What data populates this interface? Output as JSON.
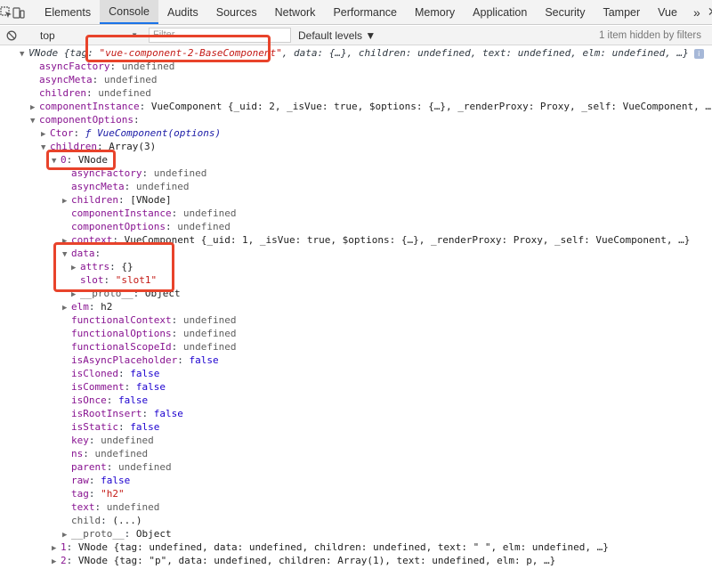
{
  "tabs": [
    "Elements",
    "Console",
    "Audits",
    "Sources",
    "Network",
    "Performance",
    "Memory",
    "Application",
    "Security",
    "Tamper",
    "Vue"
  ],
  "selected_tab": "Console",
  "more_tabs": "»",
  "toolbar": {
    "context": "top",
    "filter_placeholder": "Filter",
    "levels": "Default levels ▼",
    "hidden_count": "1 item hidden by filters"
  },
  "colors": {
    "highlight": "#e8432b",
    "tab_accent": "#1a73e8"
  },
  "console": {
    "root": {
      "head": "VNode {tag: ",
      "tag": "\"vue-component-2-BaseComponent\"",
      "tail": ", data: {…}, children: undefined, text: undefined, elm: undefined, …}"
    },
    "lines": [
      {
        "k": "asyncFactory",
        "v": "undefined"
      },
      {
        "k": "asyncMeta",
        "v": "undefined"
      },
      {
        "k": "children",
        "v": "undefined"
      },
      {
        "k": "componentInstance",
        "v": "VueComponent {_uid: 2, _isVue: true, $options: {…}, _renderProxy: Proxy, _self: VueComponent, …}"
      },
      {
        "k": "componentOptions",
        "v": ""
      },
      {
        "k": "Ctor",
        "v": "ƒ VueComponent(options)"
      },
      {
        "k": "children",
        "v": "Array(3)"
      },
      {
        "k": "0",
        "v": "VNode"
      },
      {
        "k": "asyncFactory",
        "v": "undefined"
      },
      {
        "k": "asyncMeta",
        "v": "undefined"
      },
      {
        "k": "children",
        "v": "[VNode]"
      },
      {
        "k": "componentInstance",
        "v": "undefined"
      },
      {
        "k": "componentOptions",
        "v": "undefined"
      },
      {
        "k": "context",
        "v": "VueComponent {_uid: 1, _isVue: true, $options: {…}, _renderProxy: Proxy, _self: VueComponent, …}"
      },
      {
        "k": "data",
        "v": ""
      },
      {
        "k": "attrs",
        "v": "{}"
      },
      {
        "k": "slot",
        "v": "\"slot1\""
      },
      {
        "k": "__proto__",
        "v": "Object"
      },
      {
        "k": "elm",
        "v": "h2"
      },
      {
        "k": "functionalContext",
        "v": "undefined"
      },
      {
        "k": "functionalOptions",
        "v": "undefined"
      },
      {
        "k": "functionalScopeId",
        "v": "undefined"
      },
      {
        "k": "isAsyncPlaceholder",
        "v": "false"
      },
      {
        "k": "isCloned",
        "v": "false"
      },
      {
        "k": "isComment",
        "v": "false"
      },
      {
        "k": "isOnce",
        "v": "false"
      },
      {
        "k": "isRootInsert",
        "v": "false"
      },
      {
        "k": "isStatic",
        "v": "false"
      },
      {
        "k": "key",
        "v": "undefined"
      },
      {
        "k": "ns",
        "v": "undefined"
      },
      {
        "k": "parent",
        "v": "undefined"
      },
      {
        "k": "raw",
        "v": "false"
      },
      {
        "k": "tag",
        "v": "\"h2\""
      },
      {
        "k": "text",
        "v": "undefined"
      },
      {
        "k": "child",
        "v": "(...)"
      },
      {
        "k": "__proto__",
        "v": "Object"
      },
      {
        "k": "1",
        "v": "VNode {tag: undefined, data: undefined, children: undefined, text: \" \", elm: undefined, …}"
      },
      {
        "k": "2",
        "v": "VNode {tag: \"p\", data: undefined, children: Array(1), text: undefined, elm: p, …}"
      }
    ]
  }
}
